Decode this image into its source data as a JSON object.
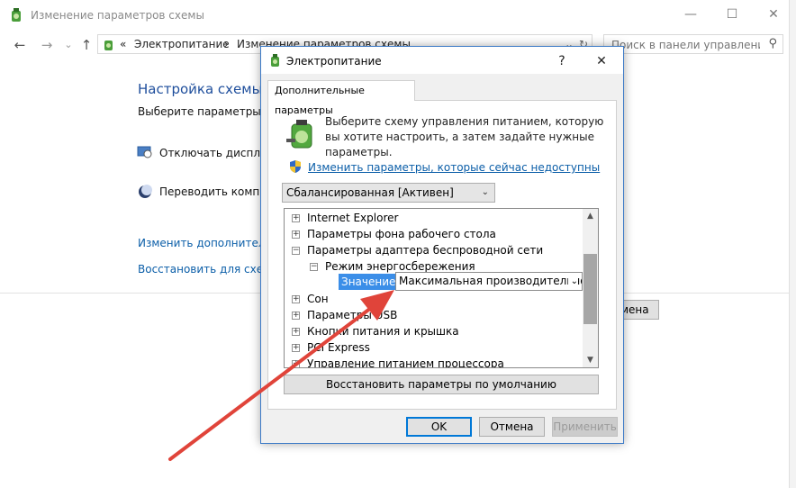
{
  "window": {
    "title": "Изменение параметров схемы",
    "minimize": "—",
    "maximize": "☐",
    "close": "✕"
  },
  "nav": {
    "back": "←",
    "forward": "→",
    "recent": "⌄",
    "up": "↑"
  },
  "address": {
    "separator": "«",
    "crumb1": "Электропитание",
    "arrow": "›",
    "crumb2": "Изменение параметров схемы",
    "dropdown": "⌄",
    "refresh": "↻"
  },
  "search": {
    "placeholder": "Поиск в панели управления"
  },
  "background_page": {
    "heading": "Настройка схемы у",
    "subtitle": "Выберите параметры пе",
    "display_off": "Отключать дисплей:",
    "sleep": "Переводить компью",
    "advanced_link": "Изменить дополнительн",
    "restore_link": "Восстановить для схемы",
    "save_button": "мена"
  },
  "dialog": {
    "title": "Электропитание",
    "help": "?",
    "close": "✕",
    "tab": "Дополнительные параметры",
    "description": "Выберите схему управления питанием, которую вы хотите настроить, а затем задайте нужные параметры.",
    "change_link": "Изменить параметры, которые сейчас недоступны",
    "scheme": "Сбалансированная [Активен]",
    "tree": [
      {
        "label": "Internet Explorer",
        "exp": "+"
      },
      {
        "label": "Параметры фона рабочего стола",
        "exp": "+"
      },
      {
        "label": "Параметры адаптера беспроводной сети",
        "exp": "−"
      },
      {
        "label": "Режим энергосбережения",
        "exp": "−"
      },
      {
        "label": "Сон",
        "exp": "+"
      },
      {
        "label": "Параметры USB",
        "exp": "+"
      },
      {
        "label": "Кнопки питания и крышка",
        "exp": "+"
      },
      {
        "label": "PCI Express",
        "exp": "+"
      },
      {
        "label": "Управление питанием процессора",
        "exp": "+"
      }
    ],
    "value_label": "Значение:",
    "value": "Максимальная производительность",
    "restore_defaults": "Восстановить параметры по умолчанию",
    "ok": "OK",
    "cancel": "Отмена",
    "apply": "Применить"
  },
  "colors": {
    "accent": "#0078d7",
    "link": "#0b5ea8",
    "selection": "#3b8ee8",
    "annotation_arrow": "#e0443a"
  }
}
